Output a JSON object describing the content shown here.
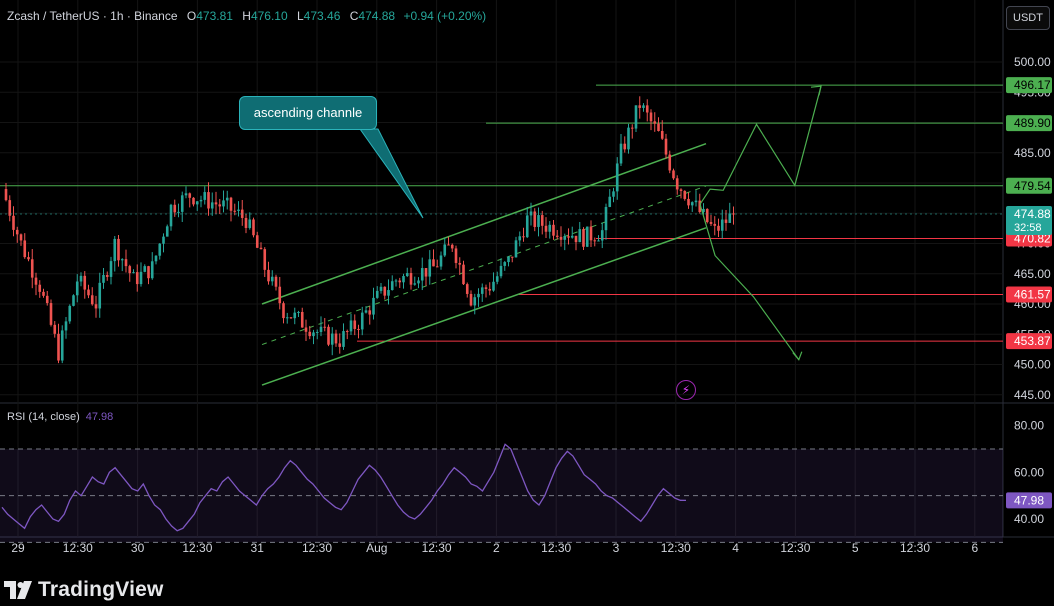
{
  "header": {
    "symbol": "Zcash / TetherUS · 1h · Binance",
    "open_label": "O",
    "open": "473.81",
    "high_label": "H",
    "high": "476.10",
    "low_label": "L",
    "low": "473.46",
    "close_label": "C",
    "close": "474.88",
    "change": "+0.94 (+0.20%)",
    "currency_button": "USDT"
  },
  "annotation": {
    "label": "ascending channle"
  },
  "brand": {
    "name": "TradingView"
  },
  "colors": {
    "up": "#26a69a",
    "down": "#ef5350",
    "level_green": "#4caf50",
    "level_red": "#f23645",
    "channel": "#4caf50",
    "rsi": "#7e57c2"
  },
  "chart_data": [
    {
      "type": "candlestick",
      "title": "Zcash / TetherUS · 1h · Binance",
      "y_axis": {
        "range": [
          442,
          502
        ],
        "ticks": [
          "500.00",
          "495.00",
          "490.00",
          "485.00",
          "480.00",
          "475.00",
          "470.00",
          "465.00",
          "460.00",
          "455.00",
          "450.00",
          "445.00"
        ]
      },
      "x_axis": {
        "ticks": [
          "29",
          "12:30",
          "30",
          "12:30",
          "31",
          "12:30",
          "Aug",
          "12:30",
          "2",
          "12:30",
          "3",
          "12:30",
          "4",
          "12:30",
          "5",
          "12:30",
          "6"
        ]
      },
      "levels": [
        {
          "price": 496.17,
          "label": "496.17",
          "color": "#4caf50"
        },
        {
          "price": 489.9,
          "label": "489.90",
          "color": "#4caf50"
        },
        {
          "price": 479.54,
          "label": "479.54",
          "color": "#4caf50"
        },
        {
          "price": 470.82,
          "label": "470.82",
          "color": "#f23645"
        },
        {
          "price": 461.57,
          "label": "461.57",
          "color": "#f23645"
        },
        {
          "price": 453.87,
          "label": "453.87",
          "color": "#f23645"
        }
      ],
      "last_price": {
        "price": 474.88,
        "label": "474.88",
        "countdown": "32:58"
      },
      "price_path": [
        {
          "t": 0,
          "p": 479
        },
        {
          "t": 1,
          "p": 470
        },
        {
          "t": 2,
          "p": 463
        },
        {
          "t": 3,
          "p": 452
        },
        {
          "t": 4,
          "p": 464
        },
        {
          "t": 5,
          "p": 460
        },
        {
          "t": 6,
          "p": 470
        },
        {
          "t": 7,
          "p": 464
        },
        {
          "t": 8,
          "p": 466
        },
        {
          "t": 9,
          "p": 476
        },
        {
          "t": 10,
          "p": 478
        },
        {
          "t": 11,
          "p": 477
        },
        {
          "t": 12,
          "p": 476
        },
        {
          "t": 13,
          "p": 474
        },
        {
          "t": 14,
          "p": 466
        },
        {
          "t": 15,
          "p": 459
        },
        {
          "t": 16,
          "p": 457
        },
        {
          "t": 17,
          "p": 455
        },
        {
          "t": 18,
          "p": 454
        },
        {
          "t": 19,
          "p": 457
        },
        {
          "t": 20,
          "p": 461
        },
        {
          "t": 21,
          "p": 464
        },
        {
          "t": 22,
          "p": 465
        },
        {
          "t": 23,
          "p": 466
        },
        {
          "t": 24,
          "p": 470
        },
        {
          "t": 25,
          "p": 461
        },
        {
          "t": 26,
          "p": 463
        },
        {
          "t": 27,
          "p": 467
        },
        {
          "t": 28,
          "p": 474
        },
        {
          "t": 29,
          "p": 473
        },
        {
          "t": 30,
          "p": 472
        },
        {
          "t": 31,
          "p": 471
        },
        {
          "t": 32,
          "p": 472
        },
        {
          "t": 33,
          "p": 485
        },
        {
          "t": 34,
          "p": 493
        },
        {
          "t": 35,
          "p": 488
        },
        {
          "t": 36,
          "p": 480
        },
        {
          "t": 37,
          "p": 476
        },
        {
          "t": 38,
          "p": 472
        },
        {
          "t": 39,
          "p": 474.88
        }
      ],
      "channel": {
        "upper": [
          [
            -13,
            460
          ],
          [
            39,
            486.5
          ]
        ],
        "lower": [
          [
            -13,
            446.6
          ],
          [
            39,
            472.6
          ]
        ],
        "mid": [
          [
            -13,
            453.3
          ],
          [
            39,
            479.5
          ]
        ]
      },
      "scenarios": {
        "bullish": [
          [
            39,
            476.5
          ],
          [
            40,
            479
          ],
          [
            41.3,
            478.8
          ],
          [
            44.6,
            489.7
          ],
          [
            48.4,
            479.6
          ],
          [
            51,
            496
          ]
        ],
        "bearish": [
          [
            39,
            476.5
          ],
          [
            40.5,
            468
          ],
          [
            44.3,
            461.2
          ],
          [
            48.8,
            450.8
          ]
        ]
      }
    },
    {
      "type": "line",
      "title": "RSI (14, close)",
      "current": "47.98",
      "y_axis": {
        "range": [
          25,
          85
        ],
        "ticks": [
          "80.00",
          "60.00",
          "40.00"
        ],
        "bands": [
          70,
          50,
          30
        ]
      },
      "series": [
        {
          "name": "RSI (14, close)",
          "values": [
            45,
            42,
            40,
            38,
            36,
            41,
            44,
            46,
            43,
            40,
            39,
            42,
            48,
            52,
            50,
            54,
            58,
            56,
            55,
            60,
            62,
            59,
            56,
            53,
            52,
            55,
            50,
            46,
            44,
            40,
            37,
            35,
            36,
            39,
            42,
            47,
            50,
            53,
            52,
            56,
            58,
            55,
            52,
            50,
            48,
            46,
            50,
            53,
            55,
            58,
            62,
            65,
            63,
            60,
            57,
            55,
            52,
            49,
            47,
            45,
            44,
            47,
            52,
            57,
            60,
            63,
            61,
            58,
            54,
            50,
            46,
            43,
            41,
            40,
            42,
            45,
            48,
            52,
            55,
            59,
            62,
            60,
            58,
            55,
            54,
            52,
            56,
            60,
            66,
            72,
            70,
            64,
            58,
            52,
            48,
            46,
            50,
            56,
            62,
            66,
            69,
            67,
            63,
            59,
            57,
            55,
            52,
            50,
            49,
            47,
            45,
            43,
            41,
            39,
            42,
            46,
            50,
            53,
            51,
            49,
            48,
            47.98
          ]
        }
      ]
    }
  ]
}
